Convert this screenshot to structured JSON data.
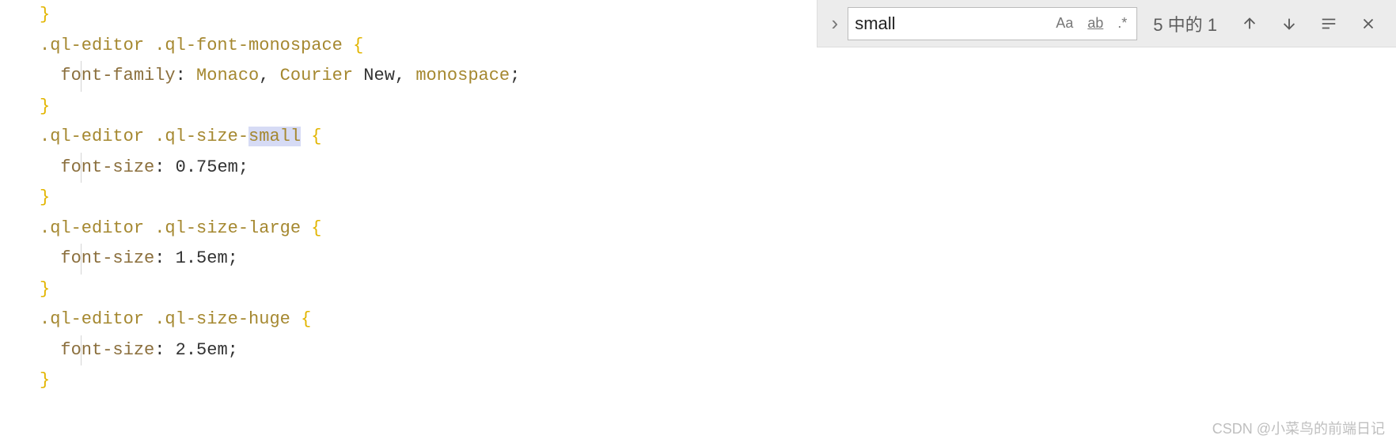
{
  "search": {
    "value": "small",
    "options": {
      "caseSensitive": "Aa",
      "wholeWord": "ab",
      "regex": ".*"
    },
    "resultText": "5 中的 1"
  },
  "code": {
    "lines": [
      {
        "indent": 0,
        "tokens": [
          {
            "t": "brace",
            "v": "}"
          }
        ]
      },
      {
        "indent": 0,
        "tokens": [
          {
            "t": "selector",
            "v": ".ql-editor .ql-font-monospace "
          },
          {
            "t": "brace",
            "v": "{"
          }
        ]
      },
      {
        "indent": 1,
        "tokens": [
          {
            "t": "property",
            "v": "font-family"
          },
          {
            "t": "value",
            "v": ": "
          },
          {
            "t": "value-keyword",
            "v": "Monaco"
          },
          {
            "t": "value",
            "v": ", "
          },
          {
            "t": "value-keyword",
            "v": "Courier"
          },
          {
            "t": "value",
            "v": " New, "
          },
          {
            "t": "value-keyword",
            "v": "monospace"
          },
          {
            "t": "semicolon",
            "v": ";"
          }
        ]
      },
      {
        "indent": 0,
        "tokens": [
          {
            "t": "brace",
            "v": "}"
          }
        ]
      },
      {
        "indent": 0,
        "tokens": [
          {
            "t": "selector",
            "v": ".ql-editor .ql-size-"
          },
          {
            "t": "selector highlight",
            "v": "small"
          },
          {
            "t": "selector",
            "v": " "
          },
          {
            "t": "brace",
            "v": "{"
          }
        ]
      },
      {
        "indent": 1,
        "tokens": [
          {
            "t": "property",
            "v": "font-size"
          },
          {
            "t": "value",
            "v": ": 0.75em"
          },
          {
            "t": "semicolon",
            "v": ";"
          }
        ]
      },
      {
        "indent": 0,
        "tokens": [
          {
            "t": "brace",
            "v": "}"
          }
        ]
      },
      {
        "indent": 0,
        "tokens": [
          {
            "t": "selector",
            "v": ".ql-editor .ql-size-large "
          },
          {
            "t": "brace",
            "v": "{"
          }
        ]
      },
      {
        "indent": 1,
        "tokens": [
          {
            "t": "property",
            "v": "font-size"
          },
          {
            "t": "value",
            "v": ": 1.5em"
          },
          {
            "t": "semicolon",
            "v": ";"
          }
        ]
      },
      {
        "indent": 0,
        "tokens": [
          {
            "t": "brace",
            "v": "}"
          }
        ]
      },
      {
        "indent": 0,
        "tokens": [
          {
            "t": "selector",
            "v": ".ql-editor .ql-size-huge "
          },
          {
            "t": "brace",
            "v": "{"
          }
        ]
      },
      {
        "indent": 1,
        "tokens": [
          {
            "t": "property",
            "v": "font-size"
          },
          {
            "t": "value",
            "v": ": 2.5em"
          },
          {
            "t": "semicolon",
            "v": ";"
          }
        ]
      },
      {
        "indent": 0,
        "tokens": [
          {
            "t": "brace",
            "v": "}"
          }
        ]
      }
    ]
  },
  "watermark": "CSDN @小菜鸟的前端日记"
}
